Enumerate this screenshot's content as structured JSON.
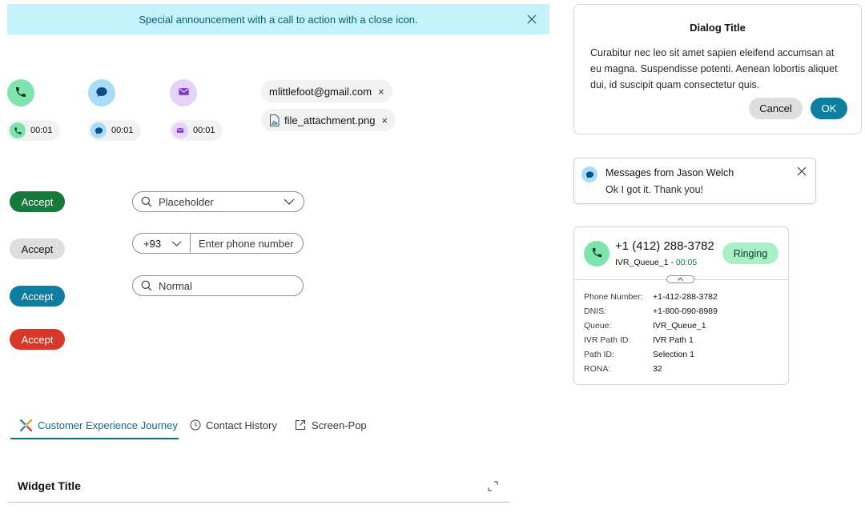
{
  "banner": {
    "text": "Special announcement with a call to action with a close icon.",
    "close_icon": "close-icon"
  },
  "avatars": {
    "call": {
      "icon": "phone-icon",
      "timer": "00:01"
    },
    "chat": {
      "icon": "chat-bubble-icon",
      "timer": "00:01"
    },
    "email": {
      "icon": "envelope-icon",
      "timer": "00:01"
    }
  },
  "chips": {
    "email": {
      "label": "mlittlefoot@gmail.com",
      "remove": "×"
    },
    "file": {
      "label": "file_attachment.png",
      "remove": "×",
      "icon": "file-image-icon"
    }
  },
  "buttons": {
    "accept_green": "Accept",
    "accept_grey": "Accept",
    "accept_blue": "Accept",
    "accept_red": "Accept"
  },
  "inputs": {
    "search_dropdown": {
      "placeholder": "Placeholder"
    },
    "phone": {
      "country_code": "+93",
      "placeholder": "Enter phone number"
    },
    "search_normal": {
      "placeholder": "Normal"
    }
  },
  "tabs": [
    {
      "label": "Customer Experience Journey",
      "active": true,
      "icon": "journey-icon"
    },
    {
      "label": "Contact History",
      "active": false,
      "icon": "clock-icon"
    },
    {
      "label": "Screen-Pop",
      "active": false,
      "icon": "external-link-icon"
    }
  ],
  "widget": {
    "title": "Widget Title",
    "expand_icon": "expand-icon"
  },
  "dialog": {
    "title": "Dialog Title",
    "body": "Curabitur nec leo sit amet sapien eleifend accumsan at eu magna. Suspendisse potenti. Aenean lobortis aliquet dui, id suscipit quam consectetur quis.",
    "cancel": "Cancel",
    "ok": "OK"
  },
  "toast": {
    "title": "Messages from Jason Welch",
    "message": "Ok I got it. Thank you!"
  },
  "call_card": {
    "phone": "+1 (412) 288-3782",
    "queue": "IVR_Queue_1",
    "separator": " - ",
    "timer": "00:05",
    "status": "Ringing",
    "details": [
      {
        "label": "Phone Number:",
        "value": "+1-412-288-3782"
      },
      {
        "label": "DNIS:",
        "value": "+1-800-090-8989"
      },
      {
        "label": "Queue:",
        "value": "IVR_Queue_1"
      },
      {
        "label": "IVR Path ID:",
        "value": "IVR Path 1"
      },
      {
        "label": "Path ID:",
        "value": "Selection 1"
      },
      {
        "label": "RONA:",
        "value": "32"
      }
    ]
  },
  "colors": {
    "banner_bg": "#c5f3fb",
    "accent_blue": "#0d7ea0",
    "accept_green": "#177a3c",
    "accept_red": "#d93829",
    "ringing_bg": "#a8f0c6"
  }
}
